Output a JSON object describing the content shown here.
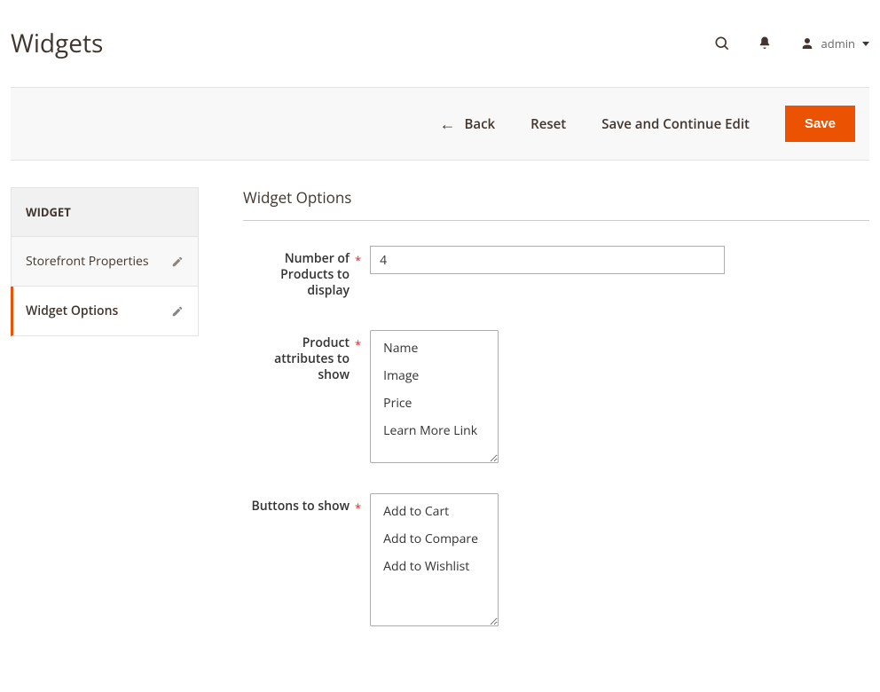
{
  "page_title": "Widgets",
  "user_name": "admin",
  "actions": {
    "back": "Back",
    "reset": "Reset",
    "save_continue": "Save and Continue Edit",
    "save": "Save"
  },
  "sidebar": {
    "title": "Widget",
    "items": [
      {
        "label": "Storefront Properties",
        "active": false
      },
      {
        "label": "Widget Options",
        "active": true
      }
    ]
  },
  "section_title": "Widget Options",
  "fields": {
    "num_products": {
      "label": "Number of Products to display",
      "value": "4"
    },
    "attrs": {
      "label": "Product attributes to show",
      "options": [
        "Name",
        "Image",
        "Price",
        "Learn More Link"
      ]
    },
    "buttons": {
      "label": "Buttons to show",
      "options": [
        "Add to Cart",
        "Add to Compare",
        "Add to Wishlist"
      ]
    }
  }
}
